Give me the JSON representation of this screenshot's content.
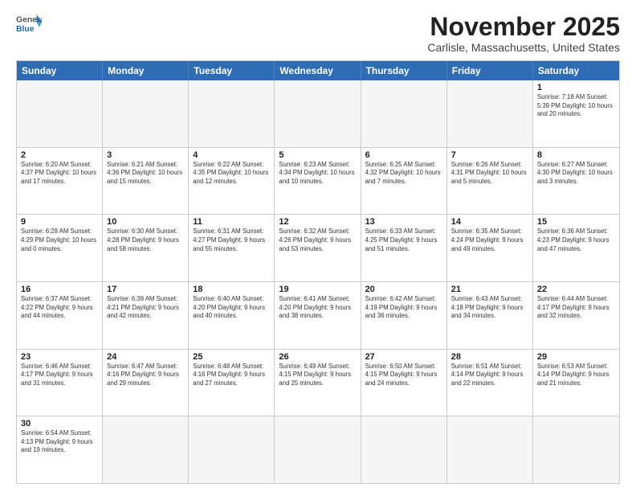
{
  "header": {
    "logo_general": "General",
    "logo_blue": "Blue",
    "month_title": "November 2025",
    "subtitle": "Carlisle, Massachusetts, United States"
  },
  "days_of_week": [
    "Sunday",
    "Monday",
    "Tuesday",
    "Wednesday",
    "Thursday",
    "Friday",
    "Saturday"
  ],
  "weeks": [
    [
      {
        "day": "",
        "info": ""
      },
      {
        "day": "",
        "info": ""
      },
      {
        "day": "",
        "info": ""
      },
      {
        "day": "",
        "info": ""
      },
      {
        "day": "",
        "info": ""
      },
      {
        "day": "",
        "info": ""
      },
      {
        "day": "1",
        "info": "Sunrise: 7:18 AM\nSunset: 5:39 PM\nDaylight: 10 hours\nand 20 minutes."
      }
    ],
    [
      {
        "day": "2",
        "info": "Sunrise: 6:20 AM\nSunset: 4:37 PM\nDaylight: 10 hours\nand 17 minutes."
      },
      {
        "day": "3",
        "info": "Sunrise: 6:21 AM\nSunset: 4:36 PM\nDaylight: 10 hours\nand 15 minutes."
      },
      {
        "day": "4",
        "info": "Sunrise: 6:22 AM\nSunset: 4:35 PM\nDaylight: 10 hours\nand 12 minutes."
      },
      {
        "day": "5",
        "info": "Sunrise: 6:23 AM\nSunset: 4:34 PM\nDaylight: 10 hours\nand 10 minutes."
      },
      {
        "day": "6",
        "info": "Sunrise: 6:25 AM\nSunset: 4:32 PM\nDaylight: 10 hours\nand 7 minutes."
      },
      {
        "day": "7",
        "info": "Sunrise: 6:26 AM\nSunset: 4:31 PM\nDaylight: 10 hours\nand 5 minutes."
      },
      {
        "day": "8",
        "info": "Sunrise: 6:27 AM\nSunset: 4:30 PM\nDaylight: 10 hours\nand 3 minutes."
      }
    ],
    [
      {
        "day": "9",
        "info": "Sunrise: 6:28 AM\nSunset: 4:29 PM\nDaylight: 10 hours\nand 0 minutes."
      },
      {
        "day": "10",
        "info": "Sunrise: 6:30 AM\nSunset: 4:28 PM\nDaylight: 9 hours\nand 58 minutes."
      },
      {
        "day": "11",
        "info": "Sunrise: 6:31 AM\nSunset: 4:27 PM\nDaylight: 9 hours\nand 55 minutes."
      },
      {
        "day": "12",
        "info": "Sunrise: 6:32 AM\nSunset: 4:26 PM\nDaylight: 9 hours\nand 53 minutes."
      },
      {
        "day": "13",
        "info": "Sunrise: 6:33 AM\nSunset: 4:25 PM\nDaylight: 9 hours\nand 51 minutes."
      },
      {
        "day": "14",
        "info": "Sunrise: 6:35 AM\nSunset: 4:24 PM\nDaylight: 9 hours\nand 49 minutes."
      },
      {
        "day": "15",
        "info": "Sunrise: 6:36 AM\nSunset: 4:23 PM\nDaylight: 9 hours\nand 47 minutes."
      }
    ],
    [
      {
        "day": "16",
        "info": "Sunrise: 6:37 AM\nSunset: 4:22 PM\nDaylight: 9 hours\nand 44 minutes."
      },
      {
        "day": "17",
        "info": "Sunrise: 6:38 AM\nSunset: 4:21 PM\nDaylight: 9 hours\nand 42 minutes."
      },
      {
        "day": "18",
        "info": "Sunrise: 6:40 AM\nSunset: 4:20 PM\nDaylight: 9 hours\nand 40 minutes."
      },
      {
        "day": "19",
        "info": "Sunrise: 6:41 AM\nSunset: 4:20 PM\nDaylight: 9 hours\nand 38 minutes."
      },
      {
        "day": "20",
        "info": "Sunrise: 6:42 AM\nSunset: 4:19 PM\nDaylight: 9 hours\nand 36 minutes."
      },
      {
        "day": "21",
        "info": "Sunrise: 6:43 AM\nSunset: 4:18 PM\nDaylight: 9 hours\nand 34 minutes."
      },
      {
        "day": "22",
        "info": "Sunrise: 6:44 AM\nSunset: 4:17 PM\nDaylight: 9 hours\nand 32 minutes."
      }
    ],
    [
      {
        "day": "23",
        "info": "Sunrise: 6:46 AM\nSunset: 4:17 PM\nDaylight: 9 hours\nand 31 minutes."
      },
      {
        "day": "24",
        "info": "Sunrise: 6:47 AM\nSunset: 4:16 PM\nDaylight: 9 hours\nand 29 minutes."
      },
      {
        "day": "25",
        "info": "Sunrise: 6:48 AM\nSunset: 4:16 PM\nDaylight: 9 hours\nand 27 minutes."
      },
      {
        "day": "26",
        "info": "Sunrise: 6:49 AM\nSunset: 4:15 PM\nDaylight: 9 hours\nand 25 minutes."
      },
      {
        "day": "27",
        "info": "Sunrise: 6:50 AM\nSunset: 4:15 PM\nDaylight: 9 hours\nand 24 minutes."
      },
      {
        "day": "28",
        "info": "Sunrise: 6:51 AM\nSunset: 4:14 PM\nDaylight: 9 hours\nand 22 minutes."
      },
      {
        "day": "29",
        "info": "Sunrise: 6:53 AM\nSunset: 4:14 PM\nDaylight: 9 hours\nand 21 minutes."
      }
    ],
    [
      {
        "day": "30",
        "info": "Sunrise: 6:54 AM\nSunset: 4:13 PM\nDaylight: 9 hours\nand 19 minutes."
      },
      {
        "day": "",
        "info": ""
      },
      {
        "day": "",
        "info": ""
      },
      {
        "day": "",
        "info": ""
      },
      {
        "day": "",
        "info": ""
      },
      {
        "day": "",
        "info": ""
      },
      {
        "day": "",
        "info": ""
      }
    ]
  ]
}
